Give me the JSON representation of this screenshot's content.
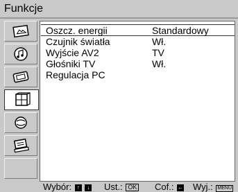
{
  "menu": {
    "title": "Funkcje",
    "active_tab": "functions-icon"
  },
  "sidebar": {
    "tabs": [
      {
        "icon": "picture-icon"
      },
      {
        "icon": "sound-icon"
      },
      {
        "icon": "screen-icon"
      },
      {
        "icon": "functions-icon"
      },
      {
        "icon": "setup-icon"
      },
      {
        "icon": "pc-icon"
      },
      {
        "icon": "empty-tab"
      }
    ]
  },
  "settings": [
    {
      "label": "Oszcz. energii",
      "value": "Standardowy"
    },
    {
      "label": "Czujnik światła",
      "value": "Wł."
    },
    {
      "label": "Wyjście AV2",
      "value": "TV"
    },
    {
      "label": "Głośniki TV",
      "value": "Wł."
    },
    {
      "label": "Regulacja PC",
      "value": ""
    }
  ],
  "footer": {
    "select_label": "Wybór:",
    "select_keys": [
      "↑",
      "↓"
    ],
    "set_label": "Ust.:",
    "set_key": "OK",
    "back_label": "Cof.:",
    "back_key": "←",
    "exit_label": "Wyj.:",
    "exit_key": "MENU"
  }
}
